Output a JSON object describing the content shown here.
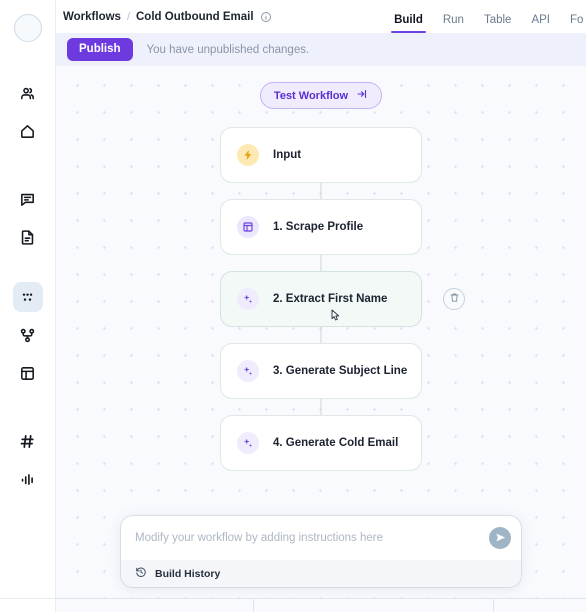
{
  "app": {
    "accent_purple": "#6d3ae0",
    "canvas_bg": "#f9fafe",
    "dot_color": "#e2e2fa"
  },
  "sidebar": {
    "avatar_label": "",
    "items": [
      {
        "name": "users-icon",
        "icon": "users",
        "label": "",
        "active": false
      },
      {
        "name": "home-icon",
        "icon": "home",
        "label": "",
        "active": false
      },
      {
        "name": "chat-icon",
        "icon": "chat",
        "label": "",
        "active": false
      },
      {
        "name": "document-icon",
        "icon": "document",
        "label": "",
        "active": false
      },
      {
        "name": "workflows-icon",
        "icon": "dots-grid",
        "label": "",
        "active": true
      },
      {
        "name": "branch-icon",
        "icon": "branch",
        "label": "",
        "active": false
      },
      {
        "name": "layout-icon",
        "icon": "layout",
        "label": "",
        "active": false
      },
      {
        "name": "hash-icon",
        "icon": "hash",
        "label": "",
        "active": false
      },
      {
        "name": "analytics-icon",
        "icon": "bars",
        "label": "",
        "active": false
      }
    ]
  },
  "header": {
    "breadcrumb_root": "Workflows",
    "breadcrumb_separator": "/",
    "breadcrumb_current": "Cold Outbound Email",
    "info_icon": "info-icon",
    "tabs": [
      {
        "label": "Build",
        "active": true
      },
      {
        "label": "Run",
        "active": false
      },
      {
        "label": "Table",
        "active": false
      },
      {
        "label": "API",
        "active": false
      },
      {
        "label": "Fo",
        "active": false
      }
    ]
  },
  "publish_bar": {
    "button_label": "Publish",
    "message": "You have unpublished changes."
  },
  "canvas": {
    "test_button": {
      "label": "Test Workflow",
      "icon": "arrow-into-bar-icon"
    },
    "nodes": [
      {
        "label": "Input",
        "icon": "zap-icon",
        "icon_style": "ico-zap",
        "hovered": false,
        "has_delete": false
      },
      {
        "label": "1. Scrape Profile",
        "icon": "browser-icon",
        "icon_style": "ico-browser",
        "hovered": false,
        "has_delete": false
      },
      {
        "label": "2. Extract First Name",
        "icon": "sparkle-icon",
        "icon_style": "ico-spark",
        "hovered": true,
        "has_delete": true
      },
      {
        "label": "3. Generate Subject Line",
        "icon": "sparkle-icon",
        "icon_style": "ico-spark",
        "hovered": false,
        "has_delete": false
      },
      {
        "label": "4. Generate Cold Email",
        "icon": "sparkle-icon",
        "icon_style": "ico-spark",
        "hovered": false,
        "has_delete": false
      }
    ]
  },
  "prompt_panel": {
    "input_value": "",
    "input_placeholder": "Modify your workflow by adding instructions here",
    "send_icon": "send-icon",
    "history_icon": "history-icon",
    "history_label": "Build History"
  }
}
